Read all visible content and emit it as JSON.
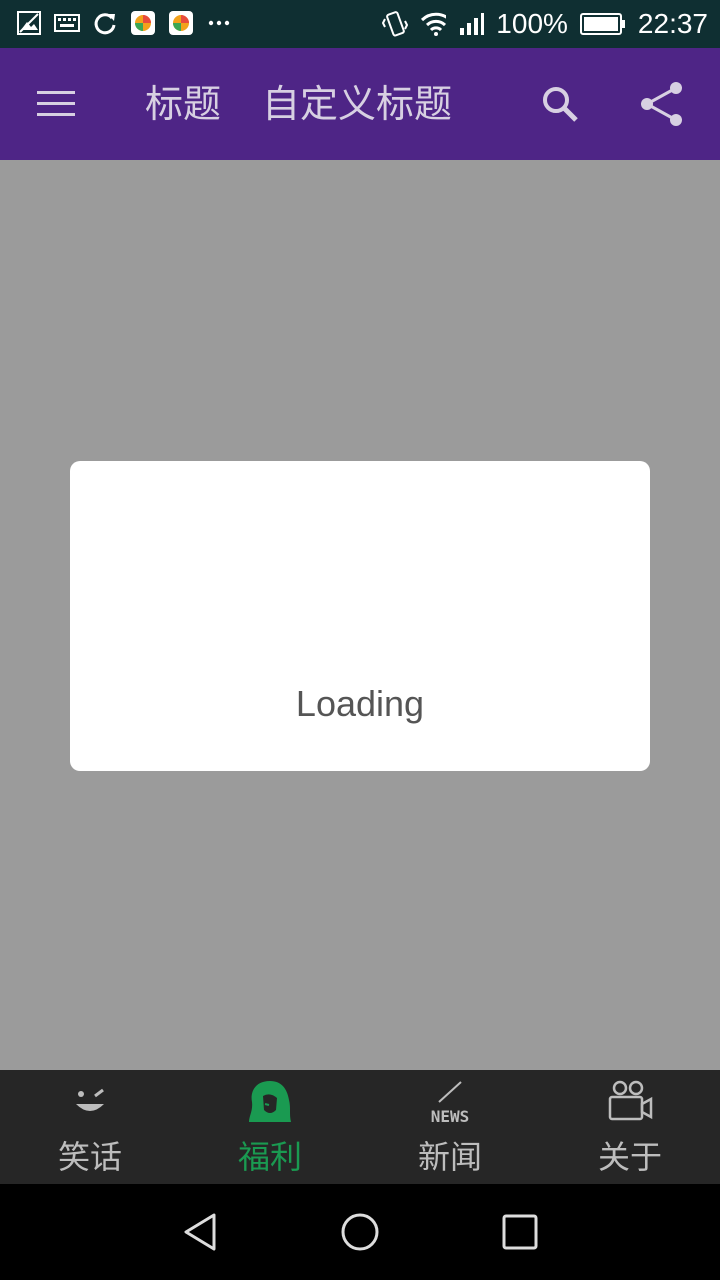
{
  "status_bar": {
    "left_icons": [
      "image-icon",
      "keyboard-icon",
      "sync-icon",
      "app-icon",
      "app-icon",
      "more-icon"
    ],
    "battery_text": "100%",
    "time": "22:37"
  },
  "app_bar": {
    "title_1": "标题",
    "title_2": "自定义标题",
    "menu_icon": "menu-icon",
    "search_icon": "search-icon",
    "share_icon": "share-icon"
  },
  "dialog": {
    "loading_text": "Loading",
    "spinner_color": "#a9df8f"
  },
  "bottom_tabs": [
    {
      "label": "笑话",
      "icon": "smiley-icon",
      "active": false
    },
    {
      "label": "福利",
      "icon": "woman-icon",
      "active": true
    },
    {
      "label": "新闻",
      "icon": "news-icon",
      "active": false
    },
    {
      "label": "关于",
      "icon": "camera-icon",
      "active": false
    }
  ],
  "colors": {
    "app_bar": "#4e2586",
    "active_tab": "#1a9a51",
    "inactive_tab": "#bdbdbd",
    "overlay": "#9b9b9b"
  }
}
